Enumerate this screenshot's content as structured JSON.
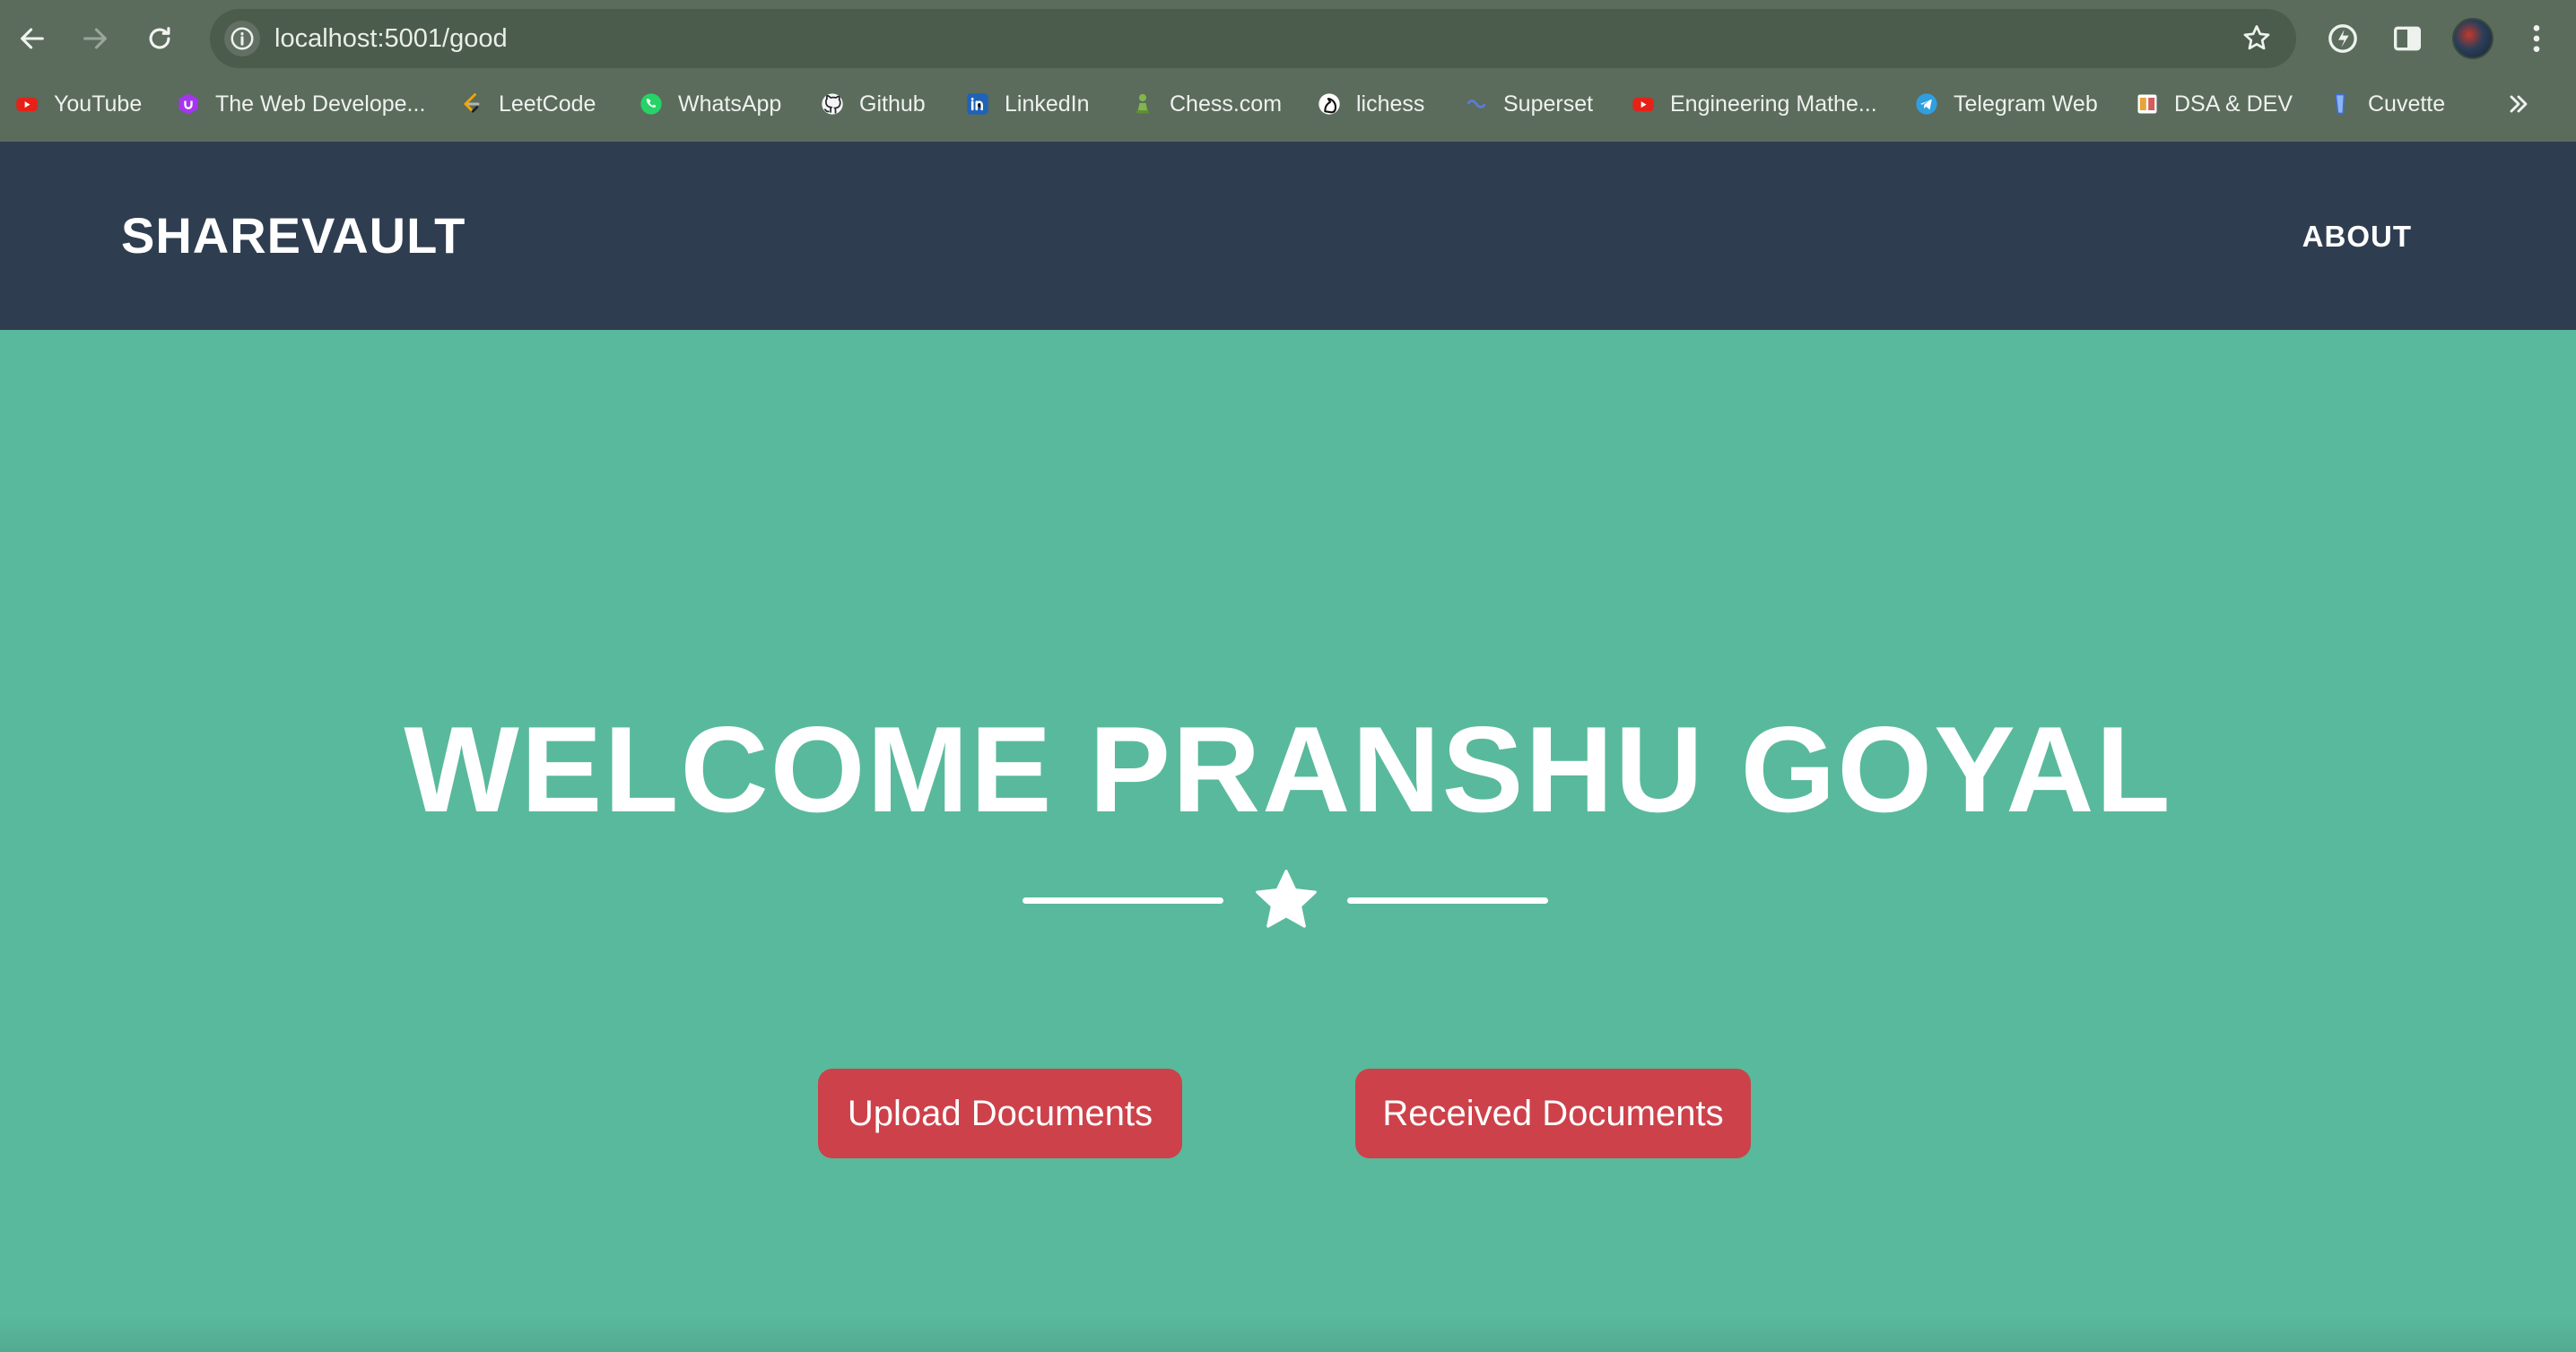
{
  "browser": {
    "url": "localhost:5001/good",
    "bookmarks": [
      {
        "label": "YouTube",
        "icon": "youtube-icon"
      },
      {
        "label": "The Web Develope...",
        "icon": "udemy-icon"
      },
      {
        "label": "LeetCode",
        "icon": "leetcode-icon"
      },
      {
        "label": "WhatsApp",
        "icon": "whatsapp-icon"
      },
      {
        "label": "Github",
        "icon": "github-icon"
      },
      {
        "label": "LinkedIn",
        "icon": "linkedin-icon"
      },
      {
        "label": "Chess.com",
        "icon": "chess-pawn-icon"
      },
      {
        "label": "lichess",
        "icon": "lichess-icon"
      },
      {
        "label": "Superset",
        "icon": "superset-icon"
      },
      {
        "label": "Engineering Mathe...",
        "icon": "youtube-icon"
      },
      {
        "label": "Telegram Web",
        "icon": "telegram-icon"
      },
      {
        "label": "DSA & DEV",
        "icon": "notebook-icon"
      },
      {
        "label": "Cuvette",
        "icon": "cuvette-icon"
      }
    ]
  },
  "navbar": {
    "brand": "SHAREVAULT",
    "about": "ABOUT"
  },
  "hero": {
    "title": "WELCOME PRANSHU GOYAL",
    "upload_button": "Upload Documents",
    "received_button": "Received Documents"
  },
  "colors": {
    "navbar": "#2f3d50",
    "hero": "#59b99c",
    "button": "#cd414a"
  }
}
